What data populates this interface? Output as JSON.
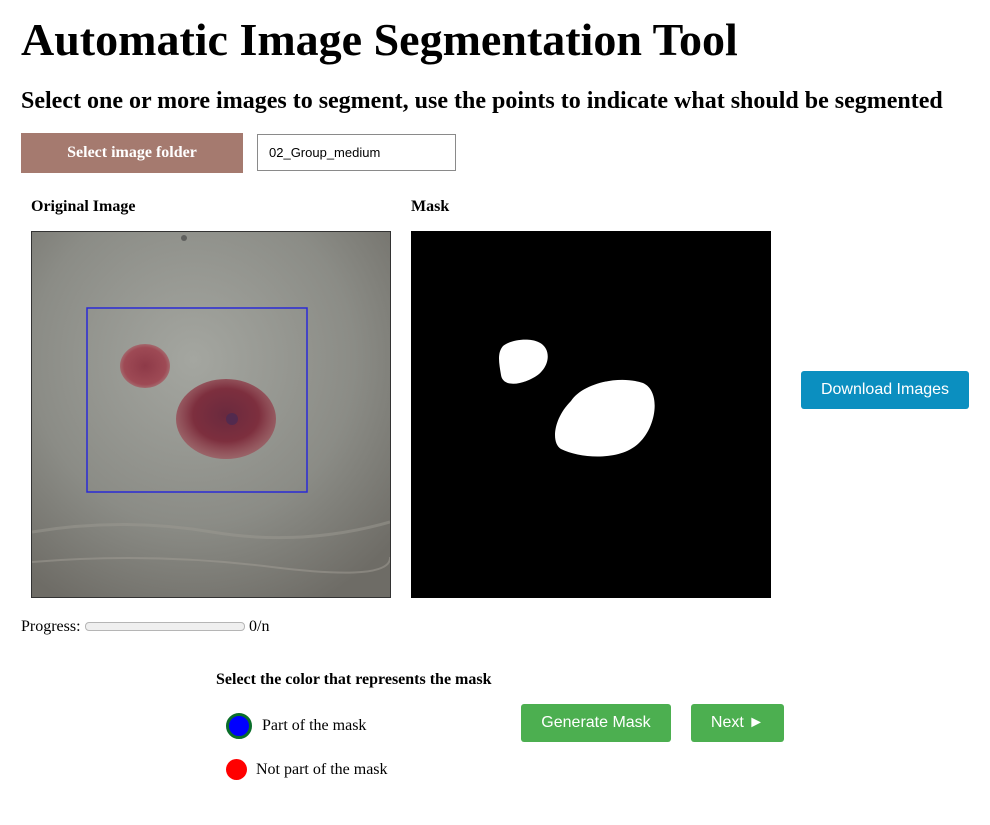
{
  "header": {
    "title": "Automatic Image Segmentation Tool",
    "subtitle": "Select one or more images to segment, use the points to indicate what should be segmented"
  },
  "folder": {
    "button_label": "Select image folder",
    "current_value": "02_Group_medium"
  },
  "panels": {
    "original_label": "Original Image",
    "mask_label": "Mask"
  },
  "download": {
    "label": "Download Images"
  },
  "progress": {
    "label": "Progress:",
    "value": 0,
    "count_text": "0/n"
  },
  "mask_color": {
    "heading": "Select the color that represents the mask",
    "options": [
      {
        "label": "Part of the mask",
        "color": "#0000ff",
        "ring_color": "#0a6e2a",
        "selected": true
      },
      {
        "label": "Not part of the mask",
        "color": "#ff0000",
        "selected": false
      }
    ]
  },
  "actions": {
    "generate_label": "Generate Mask",
    "next_label": "Next ►"
  },
  "colors": {
    "folder_button": "#a57a6f",
    "download_button": "#0b8fc0",
    "action_button": "#4caf50",
    "selection_box": "#2a2ad6"
  }
}
